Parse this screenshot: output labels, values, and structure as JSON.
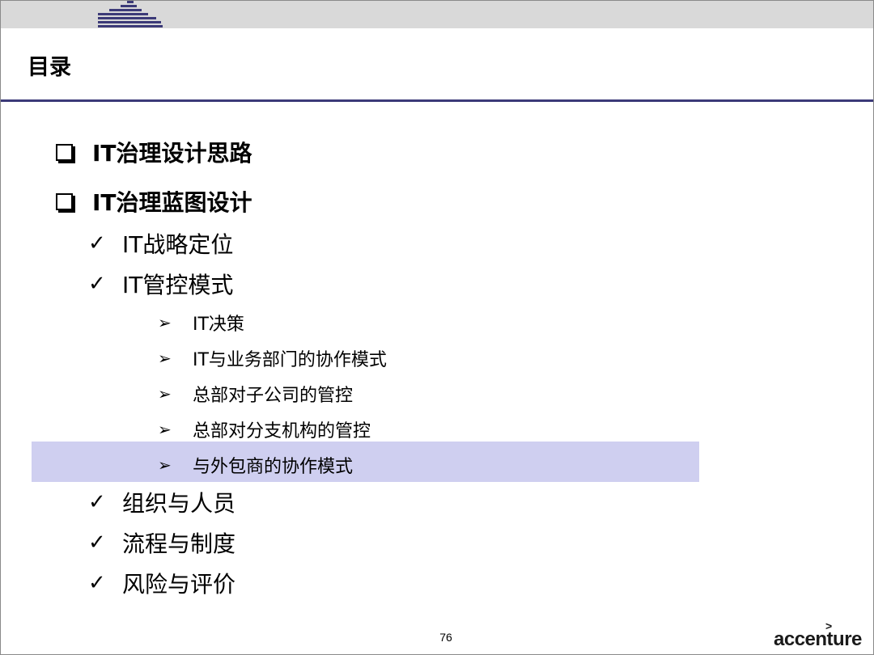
{
  "slide": {
    "title": "目录",
    "page_number": "76",
    "brand": "accenture",
    "brand_mark": ">"
  },
  "toc": [
    {
      "level": 1,
      "label": "IT治理设计思路",
      "icon": "checkbox-square-icon"
    },
    {
      "level": 1,
      "label": "IT治理蓝图设计",
      "icon": "checkbox-square-icon"
    },
    {
      "level": 2,
      "label": "IT战略定位",
      "icon": "checkmark-icon"
    },
    {
      "level": 2,
      "label": "IT管控模式",
      "icon": "checkmark-icon"
    },
    {
      "level": 3,
      "label": "IT决策",
      "icon": "arrowhead-icon"
    },
    {
      "level": 3,
      "label": "IT与业务部门的协作模式",
      "icon": "arrowhead-icon"
    },
    {
      "level": 3,
      "label": "总部对子公司的管控",
      "icon": "arrowhead-icon"
    },
    {
      "level": 3,
      "label": "总部对分支机构的管控",
      "icon": "arrowhead-icon"
    },
    {
      "level": 3,
      "label": "与外包商的协作模式",
      "icon": "arrowhead-icon",
      "highlighted": true
    },
    {
      "level": 2,
      "label": "组织与人员",
      "icon": "checkmark-icon"
    },
    {
      "level": 2,
      "label": "流程与制度",
      "icon": "checkmark-icon"
    },
    {
      "level": 2,
      "label": "风险与评价",
      "icon": "checkmark-icon"
    }
  ],
  "colors": {
    "accent_rule": "#3c3a78",
    "highlight": "#cfcff0",
    "top_band": "#d9d9d9",
    "logo_stripes": "#3c3a78"
  }
}
